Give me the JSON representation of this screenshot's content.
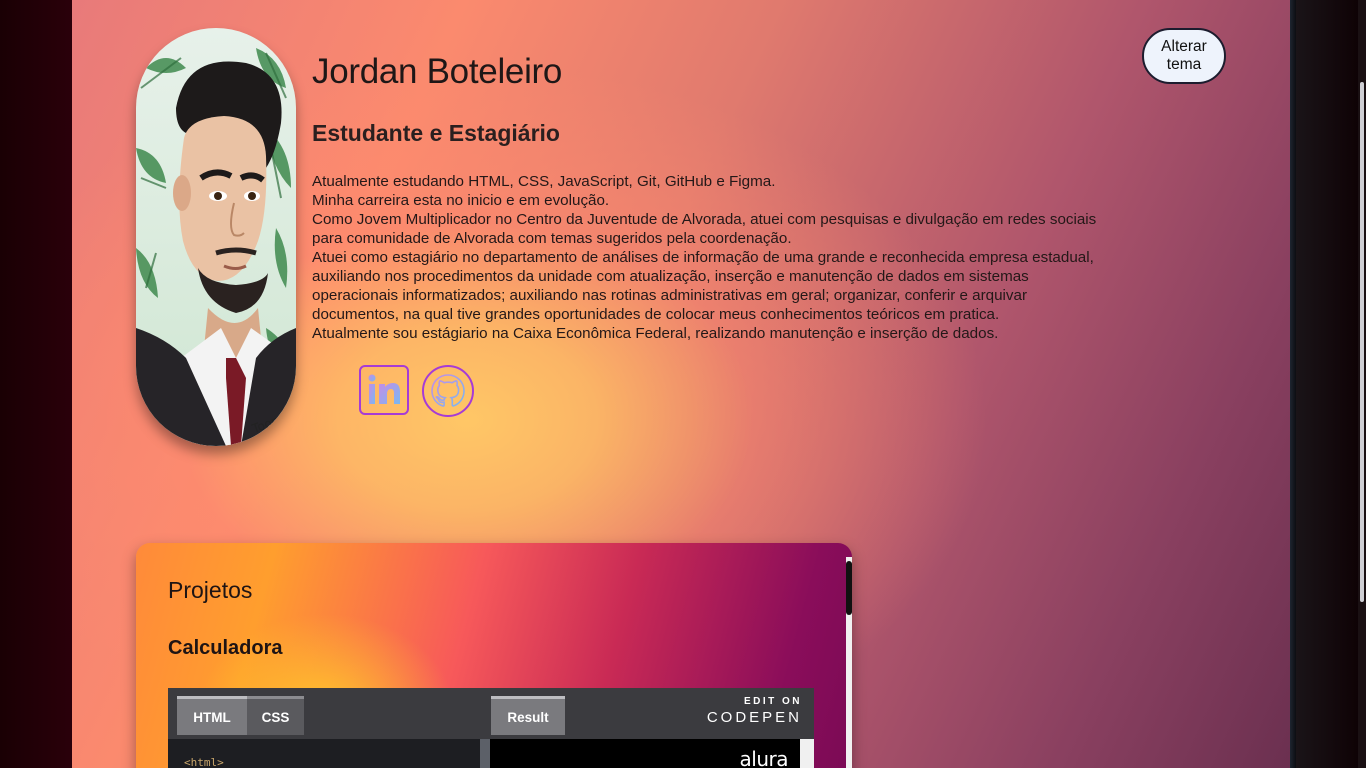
{
  "profile": {
    "name": "Jordan Boteleiro",
    "role": "Estudante e Estagiário",
    "bio": [
      "Atualmente estudando HTML, CSS, JavaScript, Git, GitHub e Figma.",
      "Minha carreira esta no inicio e em evolução.",
      "Como Jovem Multiplicador no Centro da Juventude de Alvorada, atuei com pesquisas e divulgação em redes sociais",
      "para comunidade de Alvorada com temas sugeridos pela coordenação.",
      "Atuei como estagiário no departamento de análises de informação de uma grande e reconhecida empresa estadual,",
      "auxiliando nos procedimentos da unidade com atualização, inserção e manutenção de dados em sistemas",
      "operacionais informatizados; auxiliando nas rotinas administrativas em geral; organizar, conferir e arquivar",
      "documentos, na qual tive grandes oportunidades de colocar meus conhecimentos teóricos em pratica.",
      "Atualmente sou estágiario na Caixa Econômica Federal, realizando manutenção e inserção de dados."
    ]
  },
  "social": {
    "linkedin_icon": "linkedin-icon",
    "github_icon": "github-icon"
  },
  "theme_button": {
    "line1": "Alterar",
    "line2": "tema"
  },
  "projects": {
    "title": "Projetos",
    "items": [
      {
        "name": "Calculadora"
      }
    ]
  },
  "codepen": {
    "tabs": [
      "HTML",
      "CSS"
    ],
    "result_tab": "Result",
    "edit_on": "EDIT ON",
    "logo": "CODEPEN",
    "code_line": "<html>",
    "result_brand": "alura"
  },
  "colors": {
    "accent_border": "#a63bd6",
    "theme_button_bg": "#eef3fc"
  }
}
